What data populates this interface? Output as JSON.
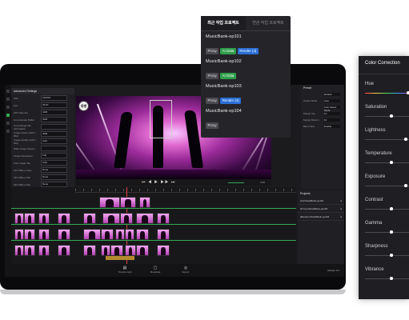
{
  "popup": {
    "tabs": [
      "최근 작업 프로젝트",
      "연관 작업 프로젝트"
    ],
    "projects": [
      {
        "name": "MusicBank-ep101",
        "tags": [
          "Proxy",
          "AI Data",
          "Render (4)"
        ]
      },
      {
        "name": "MusicBank-ep102",
        "tags": [
          "Proxy",
          "AI Data"
        ]
      },
      {
        "name": "MusicBank-ep103",
        "tags": [
          "Proxy",
          "Render (4)"
        ]
      },
      {
        "name": "MusicBank-ep104",
        "tags": [
          "Proxy"
        ]
      }
    ]
  },
  "color_correction": {
    "title": "Color Correction",
    "items": [
      {
        "label": "Hue",
        "level": 1.0
      },
      {
        "label": "Saturation",
        "level": 0.6
      },
      {
        "label": "Lightness",
        "level": 0.95
      },
      {
        "label": "Temperature",
        "level": 0.6
      },
      {
        "label": "Exposure",
        "level": 0.95
      },
      {
        "label": "Contrast",
        "level": 0.6
      },
      {
        "label": "Gamma",
        "level": 0.6
      },
      {
        "label": "Sharpness",
        "level": 0.6
      },
      {
        "label": "Vibrance",
        "level": 0.6
      }
    ]
  },
  "editor": {
    "settings_title": "Advanced Settings",
    "settings_rows": [
      {
        "label": "Size",
        "value": "1920X1"
      },
      {
        "label": "Fps",
        "value": "29.97"
      },
      {
        "label": "CPU Memory",
        "value": "4GB"
      },
      {
        "label": "Core Render Buffer",
        "value": "4GB"
      },
      {
        "label": "Core Range File Information",
        "value": ""
      },
      {
        "label": "Image Cache (GPU / RM)",
        "value": "4GB"
      },
      {
        "label": "Image Quality (GPU / RM)",
        "value": "Auto"
      },
      {
        "label": "Wide Image Stream",
        "value": ""
      },
      {
        "label": "Output Resolution",
        "value": "Full"
      },
      {
        "label": "Auto Image Tile",
        "value": "Auto"
      },
      {
        "label": "OFX Blits a View",
        "value": "None"
      },
      {
        "label": "OFX Blits a Tab",
        "value": "None"
      },
      {
        "label": "OFX Blits a Tab",
        "value": "None"
      }
    ],
    "preview_logo": "뮤뱅",
    "player_controls": "⏮ ◀ ▶ ▶▶ ⏭",
    "player_time": "0:00",
    "preset_title": "Preset",
    "preset_rows": [
      {
        "label": "",
        "value": "Default"
      },
      {
        "label": "Output Mode",
        "value": "Auto"
      },
      {
        "label": "",
        "value": "Auto Select Mode"
      },
      {
        "label": "Margin Top",
        "value": "10"
      },
      {
        "label": "Margin Bottom",
        "value": "10"
      },
      {
        "label": "Blend Size",
        "value": "Enable"
      }
    ],
    "projects_title": "Projects",
    "project_rows": [
      {
        "text": "[AI] MusicBank-ep101 ",
        "flag": "●"
      },
      {
        "text": "[Proxy] MusicBank-ep102 ",
        "flag": "●"
      },
      {
        "text": "[Render] MusicBank-ep104 ",
        "flag": "●"
      }
    ],
    "bottom_tabs": [
      "Timeline Edit",
      "Metadata",
      "Export"
    ],
    "version": "Version 0.1"
  }
}
